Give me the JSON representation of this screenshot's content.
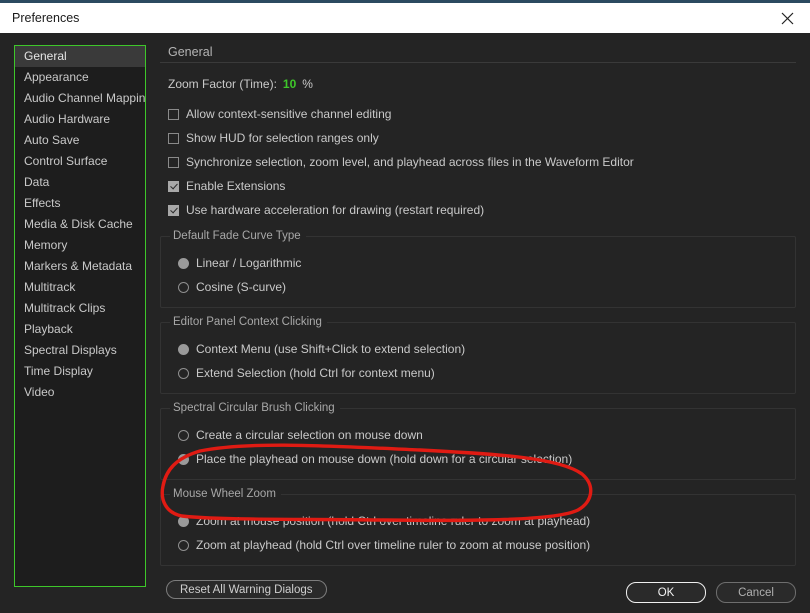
{
  "window": {
    "title": "Preferences",
    "close_icon": "close-icon",
    "accent_color": "#2b4a60"
  },
  "sidebar": {
    "selected": "General",
    "border_color": "#3ec72a",
    "items": [
      {
        "label": "General"
      },
      {
        "label": "Appearance"
      },
      {
        "label": "Audio Channel Mapping"
      },
      {
        "label": "Audio Hardware"
      },
      {
        "label": "Auto Save"
      },
      {
        "label": "Control Surface"
      },
      {
        "label": "Data"
      },
      {
        "label": "Effects"
      },
      {
        "label": "Media & Disk Cache"
      },
      {
        "label": "Memory"
      },
      {
        "label": "Markers & Metadata"
      },
      {
        "label": "Multitrack"
      },
      {
        "label": "Multitrack Clips"
      },
      {
        "label": "Playback"
      },
      {
        "label": "Spectral Displays"
      },
      {
        "label": "Time Display"
      },
      {
        "label": "Video"
      }
    ]
  },
  "main": {
    "heading": "General",
    "zoom_factor": {
      "label": "Zoom Factor (Time):",
      "value": "10",
      "unit": "%",
      "value_color": "#3ec72a"
    },
    "checkboxes": [
      {
        "label": "Allow context-sensitive channel editing",
        "checked": false
      },
      {
        "label": "Show HUD for selection ranges only",
        "checked": false
      },
      {
        "label": "Synchronize selection, zoom level, and playhead across files in the Waveform Editor",
        "checked": false
      },
      {
        "label": "Enable Extensions",
        "checked": true
      },
      {
        "label": "Use hardware acceleration for drawing (restart required)",
        "checked": true
      }
    ],
    "groups": [
      {
        "title": "Default Fade Curve Type",
        "options": [
          {
            "label": "Linear / Logarithmic",
            "selected": true
          },
          {
            "label": "Cosine (S-curve)",
            "selected": false
          }
        ]
      },
      {
        "title": "Editor Panel Context Clicking",
        "options": [
          {
            "label": "Context Menu (use Shift+Click to extend selection)",
            "selected": true
          },
          {
            "label": "Extend Selection (hold Ctrl for context menu)",
            "selected": false
          }
        ]
      },
      {
        "title": "Spectral Circular Brush Clicking",
        "options": [
          {
            "label": "Create a circular selection on mouse down",
            "selected": false
          },
          {
            "label": "Place the playhead on mouse down (hold down for a circular selection)",
            "selected": true
          }
        ]
      },
      {
        "title": "Mouse Wheel Zoom",
        "options": [
          {
            "label": "Zoom at mouse position (hold Ctrl over timeline ruler to zoom at playhead)",
            "selected": true
          },
          {
            "label": "Zoom at playhead (hold Ctrl over timeline ruler to zoom at mouse position)",
            "selected": false
          }
        ]
      }
    ],
    "reset_warnings_label": "Reset All Warning Dialogs"
  },
  "footer": {
    "ok_label": "OK",
    "cancel_label": "Cancel"
  },
  "annotation": {
    "color": "#e01b13",
    "shape": "hand-drawn-ellipse",
    "targets": "Mouse Wheel Zoom"
  }
}
